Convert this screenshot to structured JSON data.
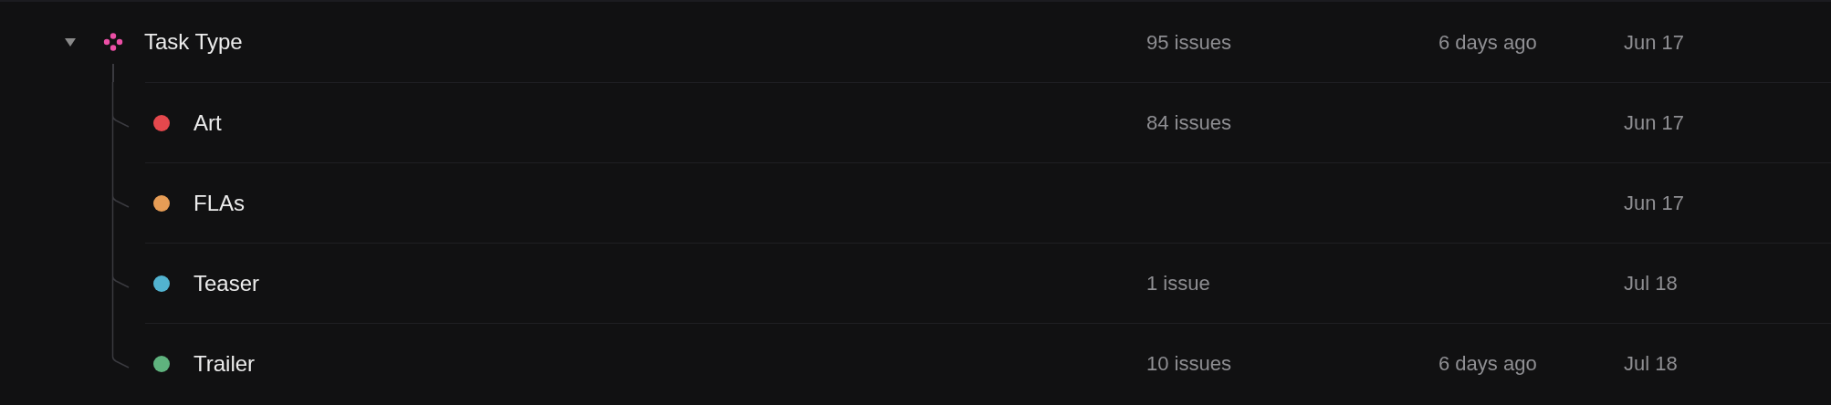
{
  "group": {
    "name": "Task Type",
    "expanded": true,
    "issues": "95 issues",
    "updated": "6 days ago",
    "date": "Jun 17",
    "children": [
      {
        "name": "Art",
        "color": "#e5484d",
        "issues": "84 issues",
        "date": "Jun 17"
      },
      {
        "name": "FLAs",
        "color": "#e79d56",
        "date": "Jun 17"
      },
      {
        "name": "Teaser",
        "color": "#52b3d0",
        "issues": "1 issue",
        "date": "Jul 18"
      },
      {
        "name": "Trailer",
        "color": "#5fb37e",
        "issues": "10 issues",
        "updated": "6 days ago",
        "date": "Jul 18"
      }
    ]
  }
}
